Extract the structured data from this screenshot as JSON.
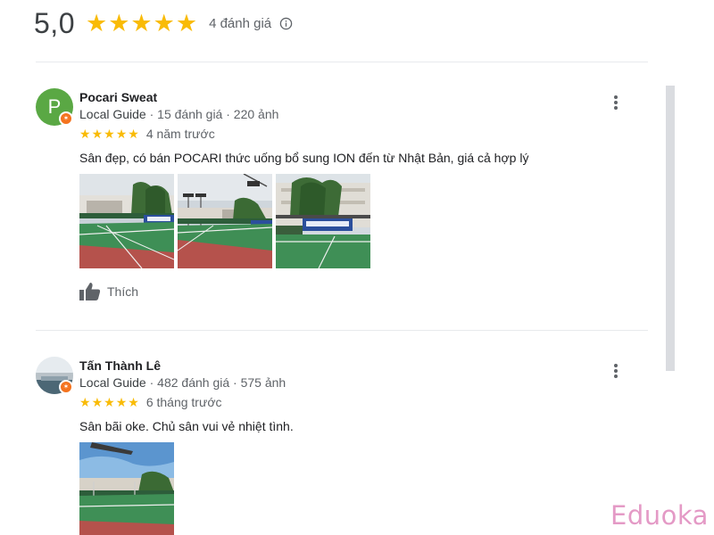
{
  "summary": {
    "rating": "5,0",
    "stars": 5,
    "review_count": "4 đánh giá",
    "star_color": "#f9bb06"
  },
  "reviews": [
    {
      "avatar_letter": "P",
      "avatar_color": "#5aa844",
      "name": "Pocari Sweat",
      "local_guide": "Local Guide",
      "stats": " · 15 đánh giá · 220 ảnh",
      "stars": 5,
      "time": "4 năm trước",
      "text": "Sân đẹp, có bán POCARI thức uống bổ sung ION đến từ Nhật Bản, giá cả hợp lý",
      "photo_count": 3,
      "like_label": "Thích"
    },
    {
      "name": "Tấn Thành Lê",
      "local_guide": "Local Guide",
      "stats": " · 482 đánh giá · 575 ảnh",
      "stars": 5,
      "time": "6 tháng trước",
      "text": "Sân bãi oke. Chủ sân vui vẻ nhiệt tình.",
      "photo_count": 1
    }
  ],
  "watermark": "Eduoka",
  "icons": {
    "info": "info-icon",
    "more": "more-vert-icon",
    "like": "thumb-up-icon",
    "guide_badge": "local-guide-badge-icon"
  }
}
